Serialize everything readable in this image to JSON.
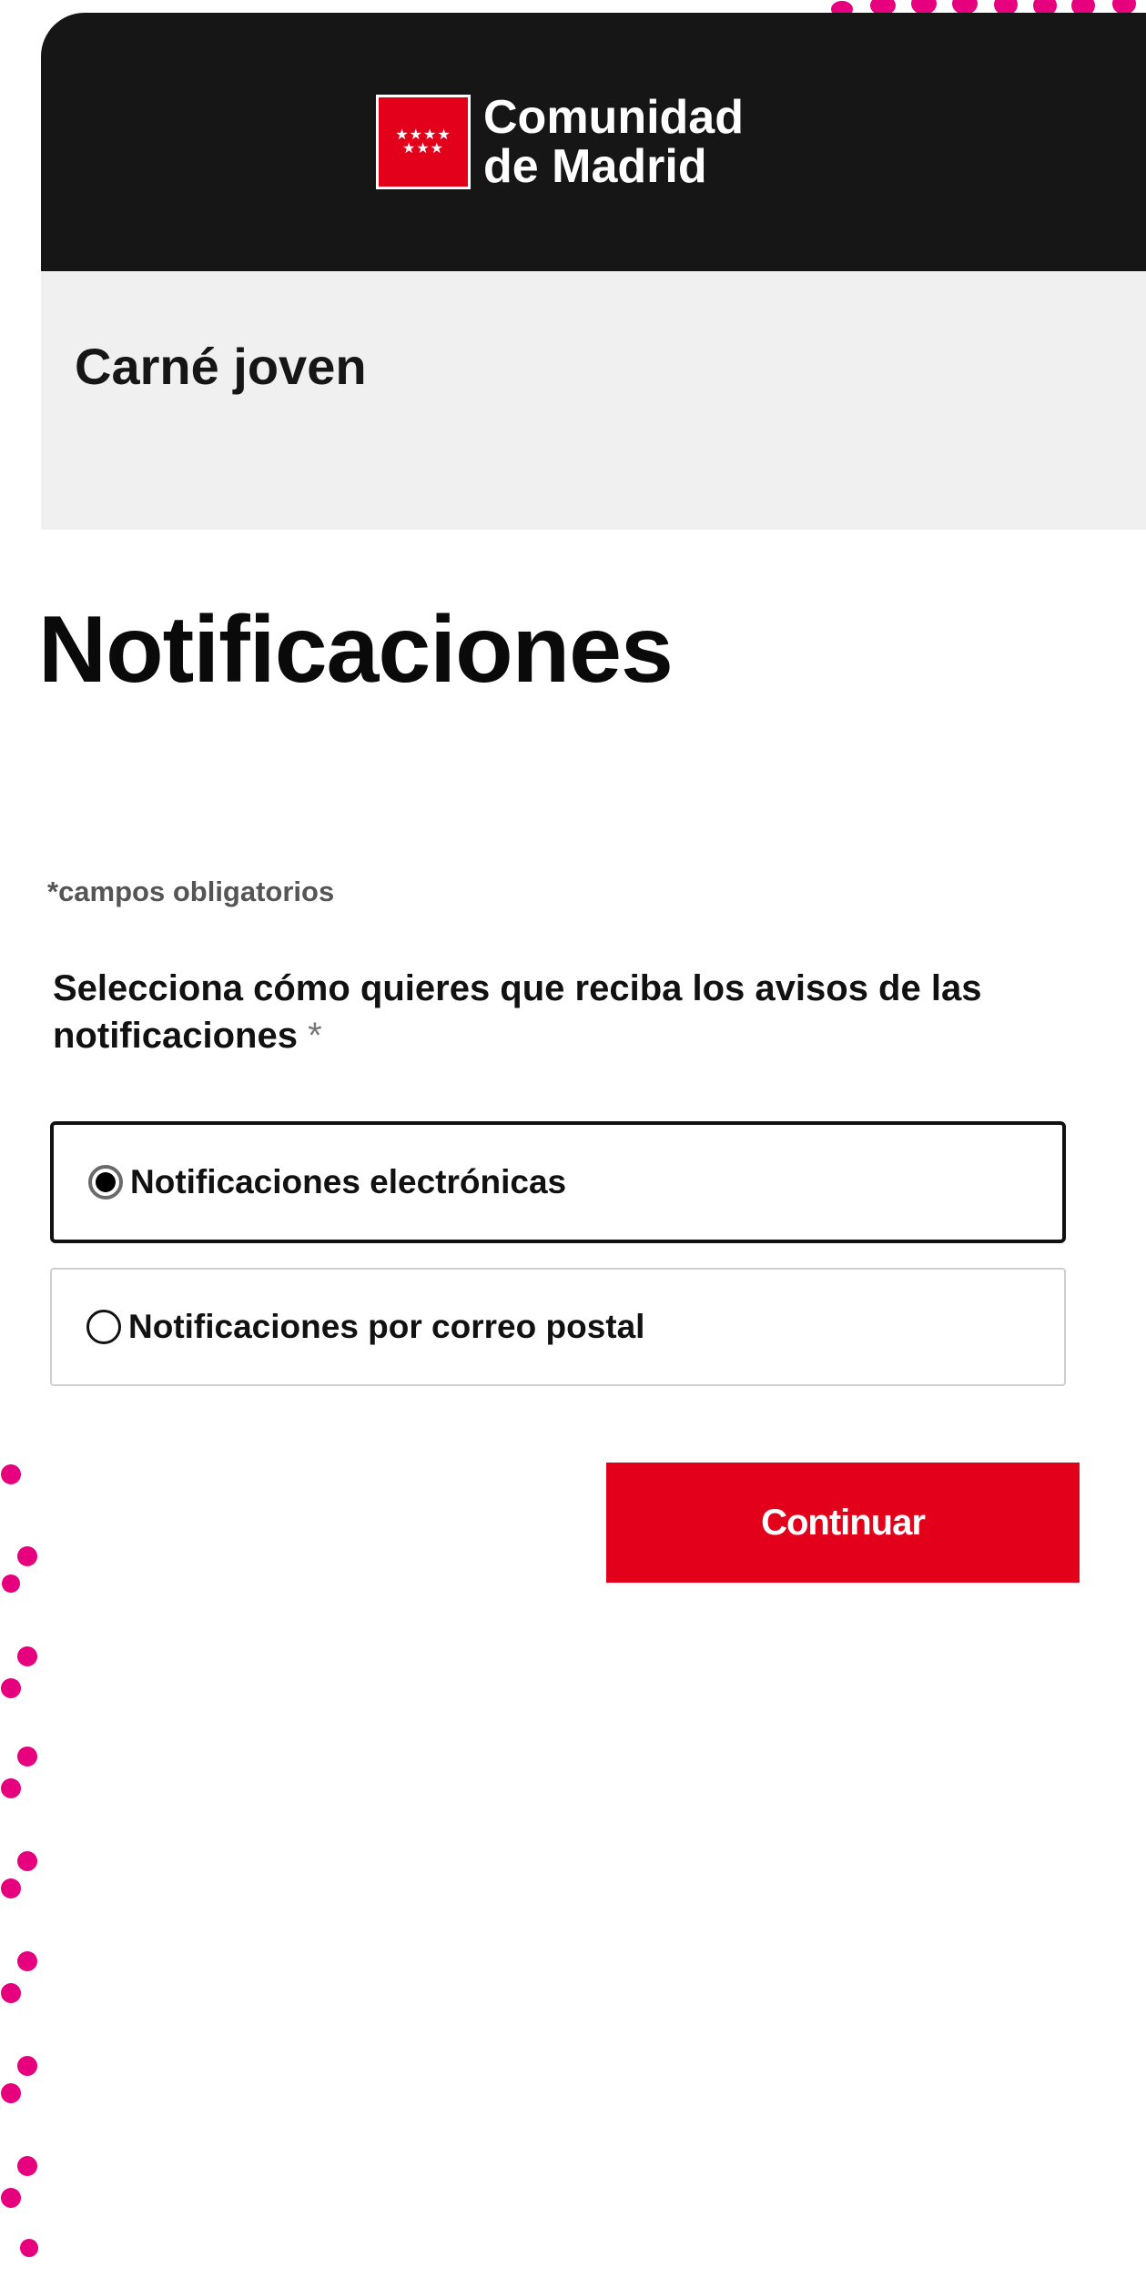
{
  "brand": {
    "name_line1": "Comunidad",
    "name_line2": "de Madrid",
    "flag_stars_row1": "★★★★",
    "flag_stars_row2": "★★★",
    "flag_color": "#e2001a"
  },
  "header": {
    "service_title": "Carné joven"
  },
  "main": {
    "title": "Notificaciones",
    "required_note": "*campos obligatorios",
    "question": "Selecciona cómo quieres que reciba los avisos de las notificaciones",
    "required_marker": "*",
    "options": [
      {
        "label": "Notificaciones electrónicas",
        "selected": true
      },
      {
        "label": "Notificaciones por correo postal",
        "selected": false
      }
    ],
    "continue_label": "Continuar"
  },
  "colors": {
    "accent": "#e2001a",
    "header_bg": "#161616",
    "subheader_bg": "#f0f0f0",
    "decor_dots": "#e6007e"
  }
}
